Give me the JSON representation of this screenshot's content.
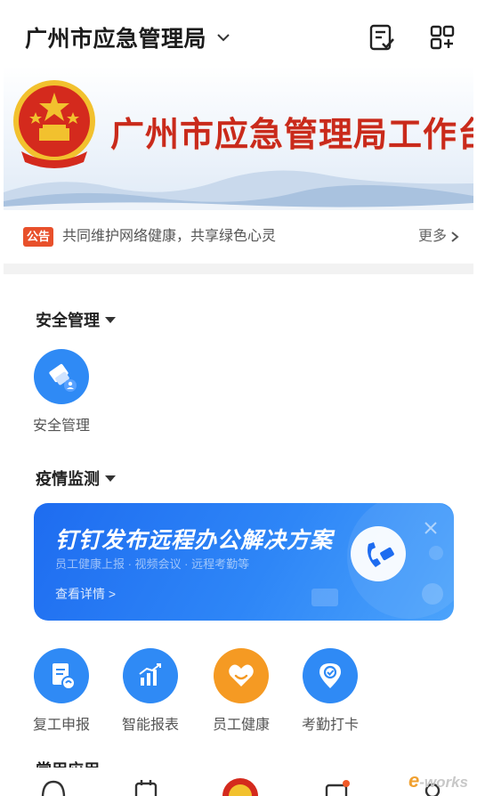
{
  "header": {
    "org_name": "广州市应急管理局",
    "icons": [
      "todo-icon",
      "qr-scan-icon"
    ]
  },
  "banner": {
    "title": "广州市应急管理局工作台",
    "emblem": "national-emblem",
    "colors": {
      "title": "#c92a1b",
      "emblem_red": "#d42a1d",
      "emblem_gold": "#f2c12e"
    }
  },
  "notice": {
    "tag": "公告",
    "text": "共同维护网络健康，共享绿色心灵",
    "more": "更多"
  },
  "sections": [
    {
      "title": "安全管理",
      "apps": [
        {
          "label": "安全管理",
          "icon": "safety-management-icon",
          "color": "#2f8af5"
        }
      ]
    },
    {
      "title": "疫情监测",
      "promo": {
        "title": "钉钉发布远程办公解决方案",
        "subtitle": "员工健康上报 · 视频会议 · 远程考勤等",
        "link": "查看详情 >"
      },
      "apps": [
        {
          "label": "复工申报",
          "icon": "return-to-work-icon",
          "color": "#2f8af5"
        },
        {
          "label": "智能报表",
          "icon": "smart-report-icon",
          "color": "#2f8af5"
        },
        {
          "label": "员工健康",
          "icon": "employee-health-icon",
          "color": "#f59a23"
        },
        {
          "label": "考勤打卡",
          "icon": "attendance-checkin-icon",
          "color": "#2f8af5"
        }
      ]
    },
    {
      "title": "常用应用"
    }
  ],
  "watermark": {
    "e": "e",
    "rest": "-works"
  }
}
